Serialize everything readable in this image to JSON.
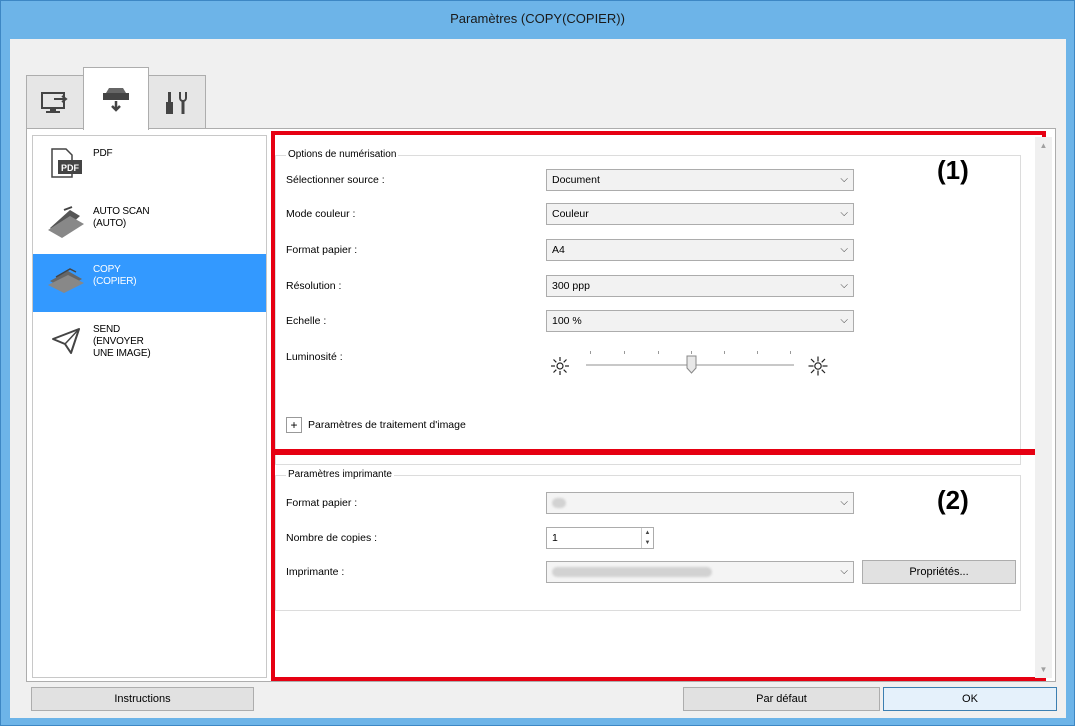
{
  "window": {
    "title": "Paramètres (COPY(COPIER))"
  },
  "tabs": [
    {
      "icon": "scan-from-computer-icon"
    },
    {
      "icon": "scan-from-panel-icon",
      "active": true
    },
    {
      "icon": "general-settings-icon"
    }
  ],
  "sidebar": {
    "items": [
      {
        "label": "PDF",
        "icon": "pdf-icon"
      },
      {
        "label": "AUTO SCAN\n(AUTO)",
        "icon": "auto-scan-icon"
      },
      {
        "label": "COPY\n(COPIER)",
        "icon": "copy-icon",
        "selected": true
      },
      {
        "label": "SEND\n(ENVOYER\nUNE IMAGE)",
        "icon": "send-icon"
      }
    ]
  },
  "scan_options": {
    "group_title": "Options de numérisation",
    "source_label": "Sélectionner source :",
    "source_value": "Document",
    "color_mode_label": "Mode couleur :",
    "color_mode_value": "Couleur",
    "paper_size_label": "Format papier :",
    "paper_size_value": "A4",
    "resolution_label": "Résolution :",
    "resolution_value": "300 ppp",
    "scale_label": "Echelle :",
    "scale_value": "100 %",
    "brightness_label": "Luminosité :",
    "brightness_level": 0.5,
    "image_processing_label": "Paramètres de traitement d'image",
    "expand_symbol": "+"
  },
  "printer_settings": {
    "group_title": "Paramètres imprimante",
    "paper_size_label": "Format papier :",
    "copies_label": "Nombre de copies :",
    "copies_value": "1",
    "printer_label": "Imprimante :",
    "properties_button": "Propriétés..."
  },
  "callouts": {
    "one": "(1)",
    "two": "(2)"
  },
  "footer": {
    "instructions_button": "Instructions",
    "default_button": "Par défaut",
    "ok_button": "OK"
  },
  "colors": {
    "highlight": "#e60012",
    "selection": "#3399ff",
    "titlebar": "#6db4e8"
  }
}
